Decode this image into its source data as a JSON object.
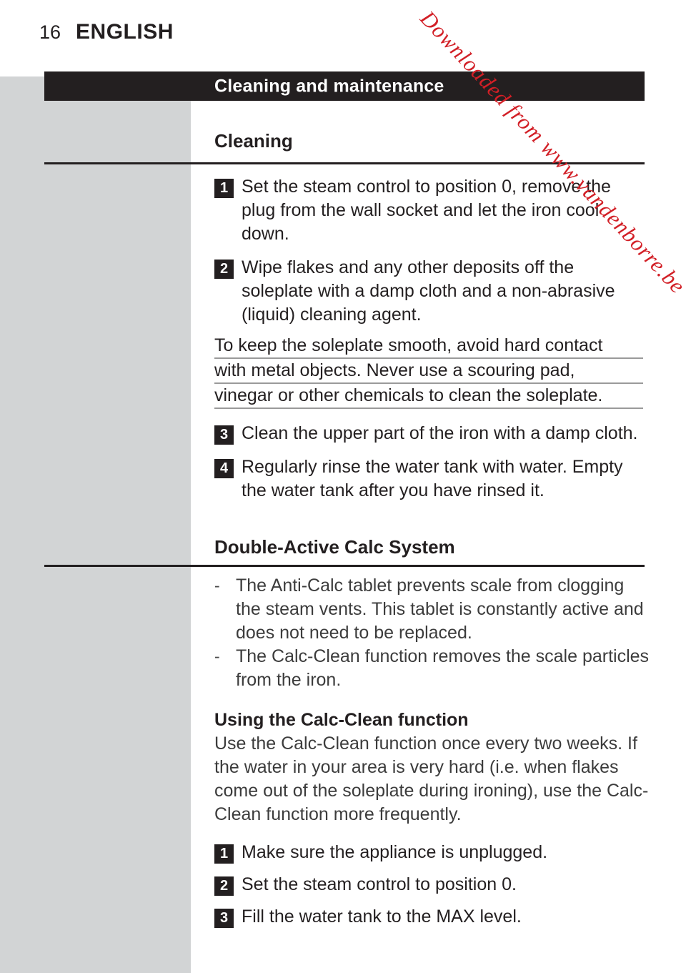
{
  "page": {
    "number": "16",
    "language": "ENGLISH",
    "watermark": "Downloaded from www.vandenborre.be",
    "watermark_color": "#d21f26",
    "band_color": "#231f20",
    "sidebar_color": "#d2d4d5"
  },
  "chapter": {
    "title": "Cleaning and maintenance"
  },
  "sections": [
    {
      "heading": "Cleaning",
      "steps": [
        {
          "num": "1",
          "text": "Set the steam control to position 0, remove the plug from the wall socket and let the iron cool down."
        },
        {
          "num": "2",
          "text": "Wipe flakes and any other deposits off the soleplate with a damp cloth and a non-abrasive (liquid) cleaning agent."
        }
      ],
      "note": {
        "lines": [
          "To keep the soleplate smooth, avoid hard contact",
          "with metal objects. Never use a scouring pad,",
          "vinegar or other chemicals to clean the soleplate."
        ]
      },
      "steps_after": [
        {
          "num": "3",
          "text": "Clean the upper part of the iron with a damp cloth."
        },
        {
          "num": "4",
          "text": "Regularly rinse the water tank with water. Empty the water tank after you have rinsed it."
        }
      ]
    },
    {
      "heading": "Double-Active Calc System",
      "bullets": [
        {
          "marker": "-",
          "text": "The Anti-Calc tablet prevents scale from clogging the steam vents. This tablet is constantly active and does not need to be replaced."
        },
        {
          "marker": "-",
          "text": "The Calc-Clean function removes the scale particles from the iron."
        }
      ],
      "subheading": "Using the Calc-Clean function",
      "paragraph": "Use the Calc-Clean function once every two weeks. If the water in your area is very hard (i.e. when flakes come out of the soleplate during ironing), use the Calc-Clean function more frequently.",
      "steps": [
        {
          "num": "1",
          "text": "Make sure the appliance is unplugged."
        },
        {
          "num": "2",
          "text": "Set the steam control to position 0."
        },
        {
          "num": "3",
          "text": "Fill the water tank to the MAX level."
        }
      ]
    }
  ]
}
